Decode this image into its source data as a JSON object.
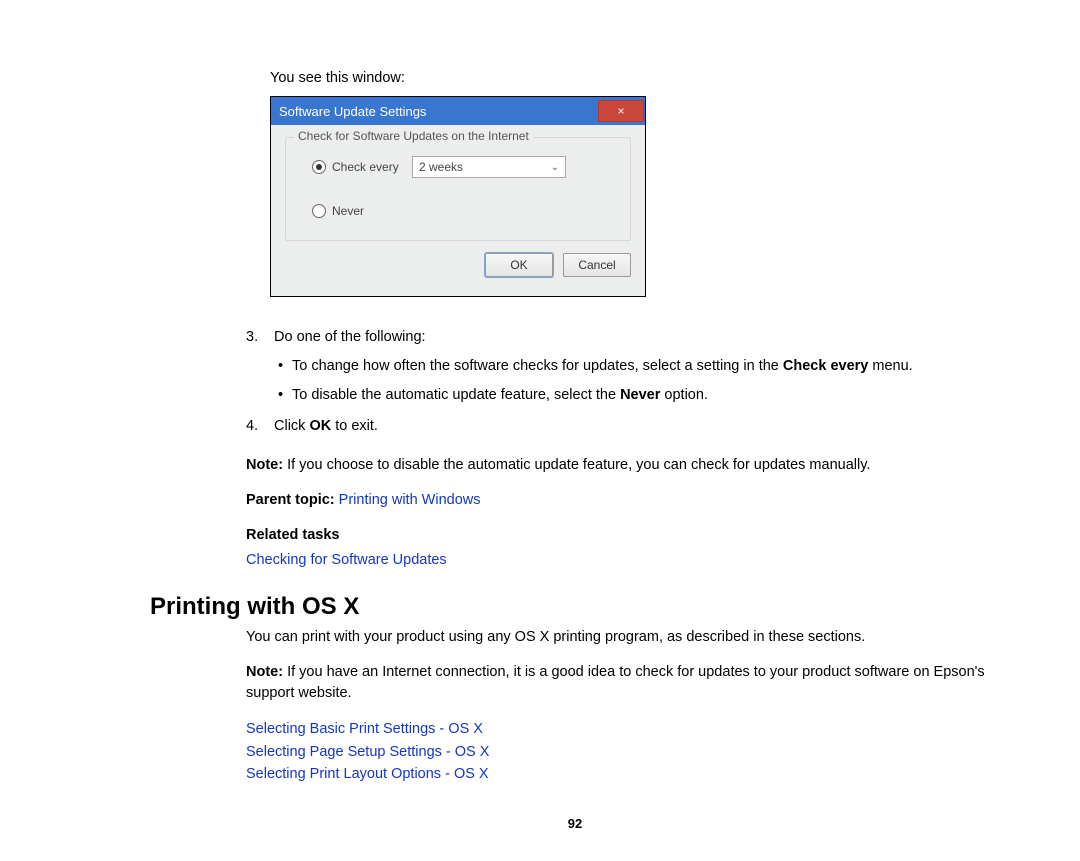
{
  "intro": "You see this window:",
  "dialog": {
    "title": "Software Update Settings",
    "close": "×",
    "legend": "Check for Software Updates on the Internet",
    "opt_check_every": "Check every",
    "opt_never": "Never",
    "select_value": "2 weeks",
    "ok": "OK",
    "cancel": "Cancel"
  },
  "step3": {
    "num": "3.",
    "text": "Do one of the following:",
    "bullet1_a": "To change how often the software checks for updates, select a setting in the ",
    "bullet1_b": "Check every",
    "bullet1_c": " menu.",
    "bullet2_a": "To disable the automatic update feature, select the ",
    "bullet2_b": "Never",
    "bullet2_c": " option."
  },
  "step4": {
    "num": "4.",
    "a": "Click ",
    "b": "OK",
    "c": " to exit."
  },
  "note1": {
    "label": "Note:",
    "text": " If you choose to disable the automatic update feature, you can check for updates manually."
  },
  "parent": {
    "label": "Parent topic: ",
    "link": "Printing with Windows"
  },
  "related": {
    "label": "Related tasks",
    "link": "Checking for Software Updates"
  },
  "heading": "Printing with OS X",
  "osx_intro": "You can print with your product using any OS X printing program, as described in these sections.",
  "note2": {
    "label": "Note:",
    "text": " If you have an Internet connection, it is a good idea to check for updates to your product software on Epson's support website."
  },
  "links": {
    "l1": "Selecting Basic Print Settings - OS X",
    "l2": "Selecting Page Setup Settings - OS X",
    "l3": "Selecting Print Layout Options - OS X"
  },
  "page_number": "92"
}
